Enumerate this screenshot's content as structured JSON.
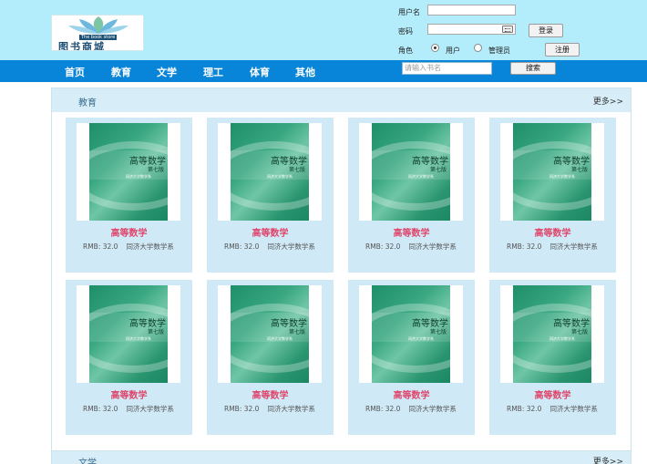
{
  "header": {
    "logo_text": "图书商城",
    "logo_sub": "The book store",
    "username_label": "用户名",
    "password_label": "密码",
    "role_label": "角色",
    "role_user": "用户",
    "role_admin": "管理员",
    "login_button": "登录",
    "register_button": "注册",
    "selected_role": "用户"
  },
  "nav": {
    "items": [
      "首页",
      "教育",
      "文学",
      "理工",
      "体育",
      "其他"
    ],
    "search_placeholder": "请输入书名",
    "search_button": "搜索"
  },
  "section": {
    "title": "教育",
    "more": "更多>>",
    "books": [
      {
        "name": "高等数学",
        "price": "RMB: 32.0",
        "author": "同济大学数学系",
        "cover_title": "高等数学",
        "cover_edition": "第七版",
        "cover_author": "同济大学数学系"
      },
      {
        "name": "高等数学",
        "price": "RMB: 32.0",
        "author": "同济大学数学系",
        "cover_title": "高等数学",
        "cover_edition": "第七版",
        "cover_author": "同济大学数学系"
      },
      {
        "name": "高等数学",
        "price": "RMB: 32.0",
        "author": "同济大学数学系",
        "cover_title": "高等数学",
        "cover_edition": "第七版",
        "cover_author": "同济大学数学系"
      },
      {
        "name": "高等数学",
        "price": "RMB: 32.0",
        "author": "同济大学数学系",
        "cover_title": "高等数学",
        "cover_edition": "第七版",
        "cover_author": "同济大学数学系"
      },
      {
        "name": "高等数学",
        "price": "RMB: 32.0",
        "author": "同济大学数学系",
        "cover_title": "高等数学",
        "cover_edition": "第七版",
        "cover_author": "同济大学数学系"
      },
      {
        "name": "高等数学",
        "price": "RMB: 32.0",
        "author": "同济大学数学系",
        "cover_title": "高等数学",
        "cover_edition": "第七版",
        "cover_author": "同济大学数学系"
      },
      {
        "name": "高等数学",
        "price": "RMB: 32.0",
        "author": "同济大学数学系",
        "cover_title": "高等数学",
        "cover_edition": "第七版",
        "cover_author": "同济大学数学系"
      },
      {
        "name": "高等数学",
        "price": "RMB: 32.0",
        "author": "同济大学数学系",
        "cover_title": "高等数学",
        "cover_edition": "第七版",
        "cover_author": "同济大学数学系"
      }
    ]
  },
  "section2": {
    "title": "文学",
    "more": "更多>>"
  },
  "colors": {
    "header_bg": "#b3ecfb",
    "nav_bg": "#0885d8",
    "card_bg": "#cfe9f6",
    "book_name": "#e0476c"
  }
}
